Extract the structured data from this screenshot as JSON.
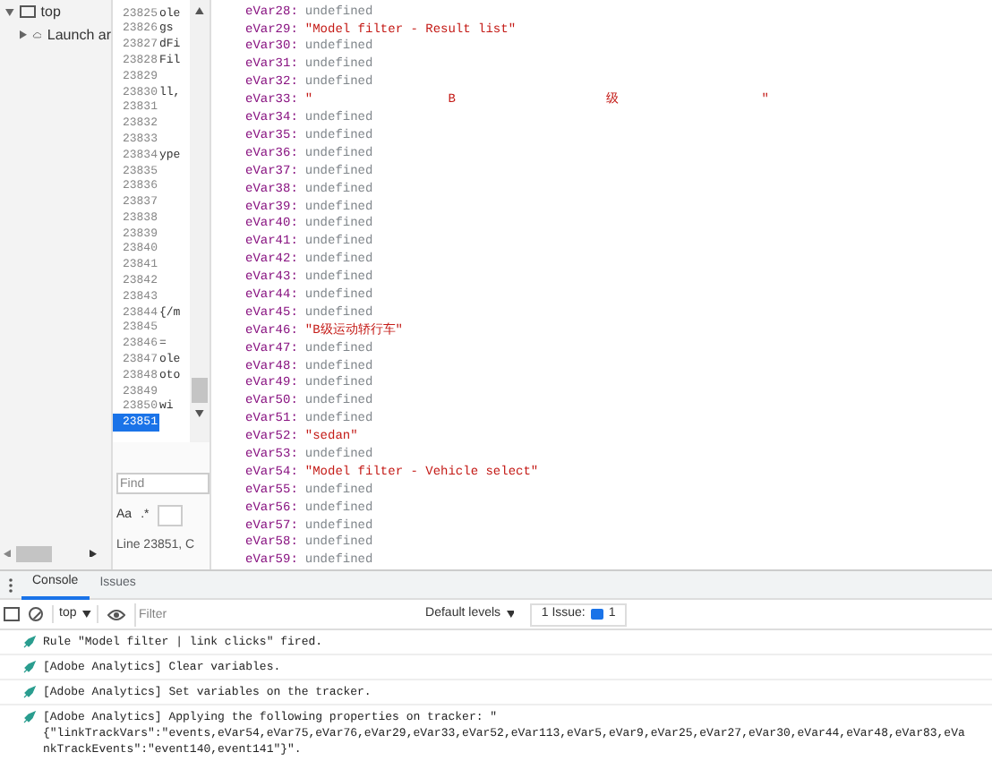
{
  "navigator": {
    "items": [
      {
        "label": "top",
        "expanded": true,
        "children": [
          {
            "label": "Launch ar",
            "expanded": false
          }
        ]
      }
    ]
  },
  "editor": {
    "lines": [
      {
        "number": "23825",
        "code": "ole",
        "selected": false
      },
      {
        "number": "23826",
        "code": "gs",
        "selected": false
      },
      {
        "number": "23827",
        "code": "dFi",
        "selected": false
      },
      {
        "number": "23828",
        "code": "Fil",
        "selected": false
      },
      {
        "number": "23829",
        "selected": false
      },
      {
        "number": "23830",
        "code": "ll,",
        "selected": false
      },
      {
        "number": "23831",
        "selected": false
      },
      {
        "number": "23832",
        "selected": false
      },
      {
        "number": "23833",
        "selected": false
      },
      {
        "number": "23834",
        "code": "ype",
        "selected": false
      },
      {
        "number": "23835",
        "selected": false
      },
      {
        "number": "23836",
        "selected": false
      },
      {
        "number": "23837",
        "selected": false
      },
      {
        "number": "23838",
        "selected": false
      },
      {
        "number": "23839",
        "selected": false
      },
      {
        "number": "23840",
        "selected": false
      },
      {
        "number": "23841",
        "selected": false
      },
      {
        "number": "23842",
        "selected": false
      },
      {
        "number": "23843",
        "selected": false
      },
      {
        "number": "23844",
        "code": "{/m",
        "selected": false
      },
      {
        "number": "23845",
        "selected": false
      },
      {
        "number": "23846",
        "code": "=",
        "selected": false
      },
      {
        "number": "23847",
        "code": "ole",
        "selected": false
      },
      {
        "number": "23848",
        "code": "oto",
        "selected": false
      },
      {
        "number": "23849",
        "selected": false
      },
      {
        "number": "23850",
        "code": "wi",
        "selected": false
      },
      {
        "number": "23851",
        "selected": true
      }
    ],
    "find": {
      "placeholder": "Find"
    },
    "match_case": "Aa",
    "regex": ".*",
    "status": "Line 23851, C"
  },
  "scope": {
    "rows": [
      {
        "key": "eVar28:",
        "value": "undefined",
        "kind": "undefined"
      },
      {
        "key": "eVar29:",
        "value": "\"Model filter - Result list\"",
        "kind": "string"
      },
      {
        "key": "eVar30:",
        "value": "undefined",
        "kind": "undefined"
      },
      {
        "key": "eVar31:",
        "value": "undefined",
        "kind": "undefined"
      },
      {
        "key": "eVar32:",
        "value": "undefined",
        "kind": "undefined"
      },
      {
        "key": "eVar33:",
        "value": "\"                  B                    级                   \"",
        "kind": "string"
      },
      {
        "key": "eVar34:",
        "value": "undefined",
        "kind": "undefined"
      },
      {
        "key": "eVar35:",
        "value": "undefined",
        "kind": "undefined"
      },
      {
        "key": "eVar36:",
        "value": "undefined",
        "kind": "undefined"
      },
      {
        "key": "eVar37:",
        "value": "undefined",
        "kind": "undefined"
      },
      {
        "key": "eVar38:",
        "value": "undefined",
        "kind": "undefined"
      },
      {
        "key": "eVar39:",
        "value": "undefined",
        "kind": "undefined"
      },
      {
        "key": "eVar40:",
        "value": "undefined",
        "kind": "undefined"
      },
      {
        "key": "eVar41:",
        "value": "undefined",
        "kind": "undefined"
      },
      {
        "key": "eVar42:",
        "value": "undefined",
        "kind": "undefined"
      },
      {
        "key": "eVar43:",
        "value": "undefined",
        "kind": "undefined"
      },
      {
        "key": "eVar44:",
        "value": "undefined",
        "kind": "undefined"
      },
      {
        "key": "eVar45:",
        "value": "undefined",
        "kind": "undefined"
      },
      {
        "key": "eVar46:",
        "value": "\"B级运动轿行车\"",
        "kind": "string"
      },
      {
        "key": "eVar47:",
        "value": "undefined",
        "kind": "undefined"
      },
      {
        "key": "eVar48:",
        "value": "undefined",
        "kind": "undefined"
      },
      {
        "key": "eVar49:",
        "value": "undefined",
        "kind": "undefined"
      },
      {
        "key": "eVar50:",
        "value": "undefined",
        "kind": "undefined"
      },
      {
        "key": "eVar51:",
        "value": "undefined",
        "kind": "undefined"
      },
      {
        "key": "eVar52:",
        "value": "\"sedan\"",
        "kind": "string"
      },
      {
        "key": "eVar53:",
        "value": "undefined",
        "kind": "undefined"
      },
      {
        "key": "eVar54:",
        "value": "\"Model filter - Vehicle select\"",
        "kind": "string"
      },
      {
        "key": "eVar55:",
        "value": "undefined",
        "kind": "undefined"
      },
      {
        "key": "eVar56:",
        "value": "undefined",
        "kind": "undefined"
      },
      {
        "key": "eVar57:",
        "value": "undefined",
        "kind": "undefined"
      },
      {
        "key": "eVar58:",
        "value": "undefined",
        "kind": "undefined"
      },
      {
        "key": "eVar59:",
        "value": "undefined",
        "kind": "undefined"
      }
    ]
  },
  "console": {
    "tabs": [
      {
        "label": "Console",
        "selected": true
      },
      {
        "label": "Issues",
        "selected": false
      }
    ],
    "context": "top",
    "filter": {
      "placeholder": "Filter"
    },
    "levels": "Default levels",
    "issues": {
      "label": "1 Issue:",
      "count": "1"
    },
    "messages": [
      {
        "lines": [
          "Rule \"Model filter | link clicks\" fired."
        ]
      },
      {
        "lines": [
          "[Adobe Analytics] Clear variables."
        ]
      },
      {
        "lines": [
          "[Adobe Analytics] Set variables on the tracker."
        ]
      },
      {
        "lines": [
          "[Adobe Analytics] Applying the following properties on tracker: \"",
          "{\"linkTrackVars\":\"events,eVar54,eVar75,eVar76,eVar29,eVar33,eVar52,eVar113,eVar5,eVar9,eVar25,eVar27,eVar30,eVar44,eVar48,eVar83,eVa",
          "nkTrackEvents\":\"event140,event141\"}\"."
        ]
      }
    ]
  }
}
